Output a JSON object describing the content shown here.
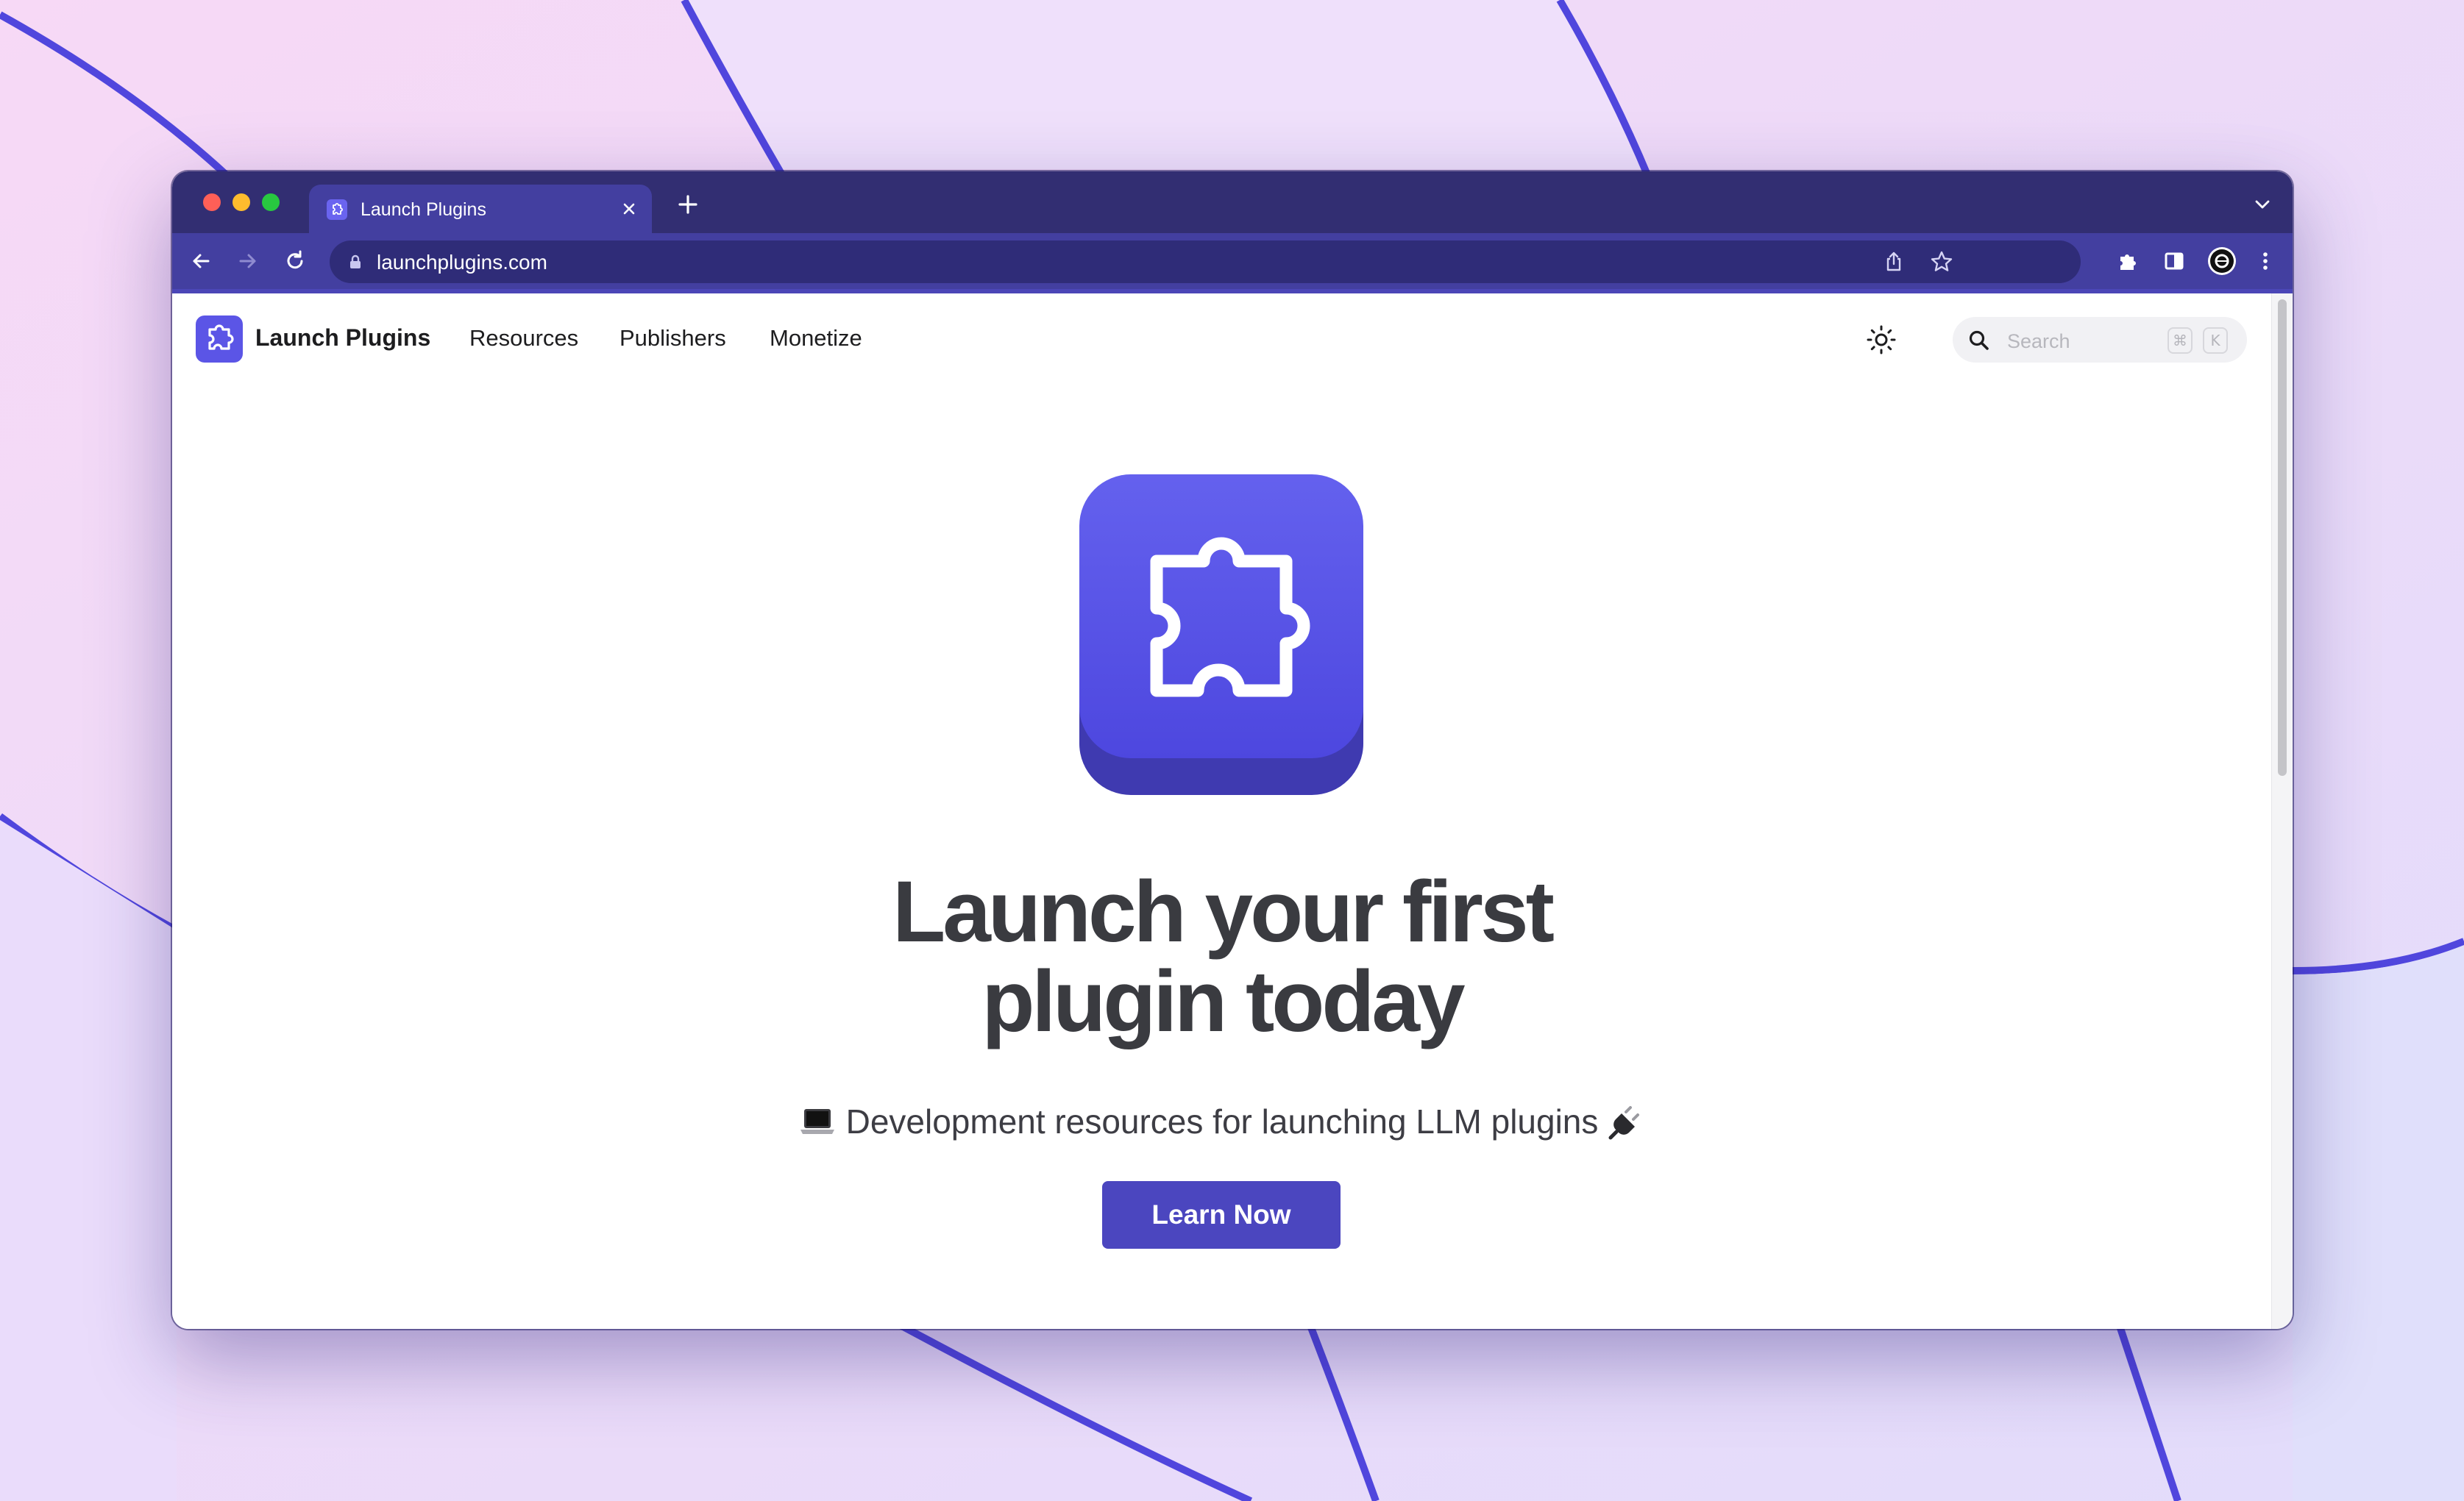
{
  "browser": {
    "tab_title": "Launch Plugins",
    "url": "launchplugins.com"
  },
  "nav": {
    "brand": "Launch Plugins",
    "links": [
      "Resources",
      "Publishers",
      "Monetize"
    ],
    "search_placeholder": "Search",
    "shortcut_keys": [
      "⌘",
      "K"
    ]
  },
  "hero": {
    "title_line1": "Launch your first",
    "title_line2": "plugin today",
    "subtitle": "Development resources for launching LLM plugins",
    "cta": "Learn Now",
    "subtitle_leading_icon": "laptop-icon",
    "subtitle_trailing_icon": "plug-icon"
  },
  "colors": {
    "brand": "#4b46bf",
    "tabstrip": "#322e72",
    "toolbar": "#433fa0"
  }
}
